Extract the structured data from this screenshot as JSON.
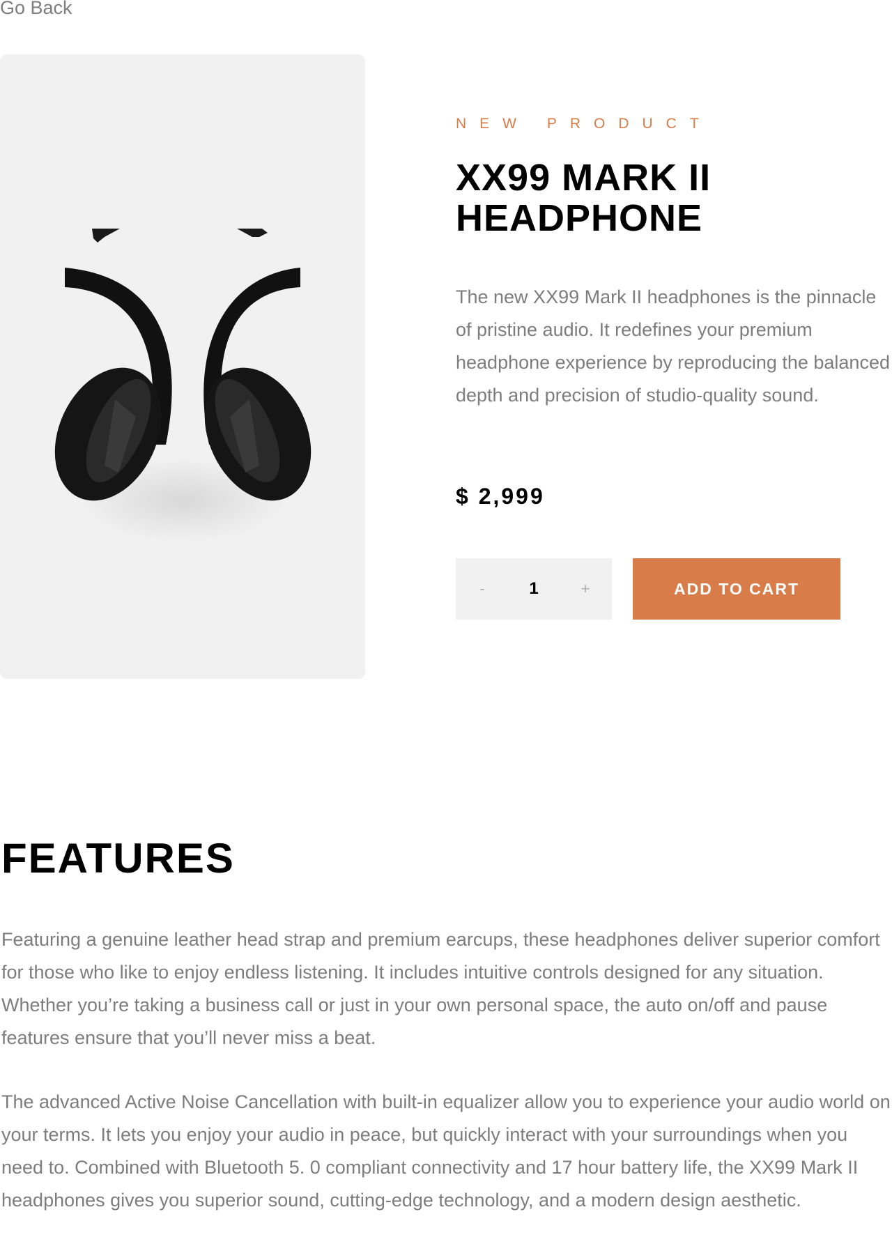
{
  "nav": {
    "go_back_label": "Go Back"
  },
  "product": {
    "overline": "NEW PRODUCT",
    "title": "XX99 MARK II HEADPHONE",
    "description": "The new XX99 Mark II headphones is the pinnacle of pristine audio. It redefines your premium headphone experience by reproducing the balanced depth and precision of studio-quality sound.",
    "price": "$ 2,999",
    "image_alt": "headphones",
    "quantity": {
      "decrement_label": "-",
      "value": "1",
      "increment_label": "+"
    },
    "add_to_cart_label": "ADD TO CART"
  },
  "features": {
    "heading": "FEATURES",
    "paragraphs": [
      "Featuring a genuine leather head strap and premium earcups, these headphones deliver superior comfort for those who like to enjoy endless listening. It includes intuitive controls designed for any situation. Whether you’re taking a business call or just in your own personal space, the auto on/off and pause features ensure that you’ll never miss a beat.",
      "The advanced Active Noise Cancellation with built-in equalizer allow you to experience your audio world on your terms. It lets you enjoy your audio in peace, but quickly interact with your surroundings when you need to. Combined with Bluetooth 5. 0 compliant connectivity and 17 hour battery life, the XX99 Mark II headphones gives you superior sound, cutting-edge technology, and a modern design aesthetic."
    ]
  },
  "colors": {
    "accent": "#d87d4a",
    "muted_text": "#7d7d7d",
    "card_background": "#f1f1f1",
    "text": "#000000"
  }
}
